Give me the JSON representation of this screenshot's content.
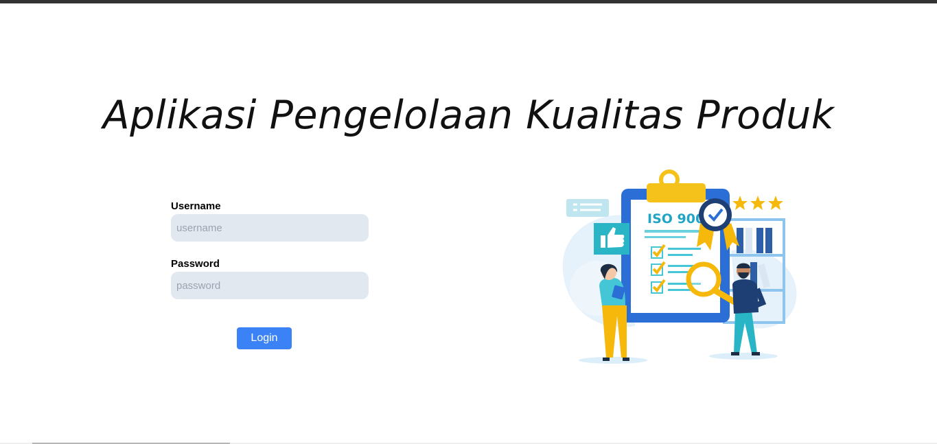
{
  "page": {
    "title": "Aplikasi Pengelolaan Kualitas Produk"
  },
  "login_form": {
    "username_label": "Username",
    "username_placeholder": "username",
    "username_value": "",
    "password_label": "Password",
    "password_placeholder": "password",
    "password_value": "",
    "login_button_label": "Login"
  },
  "illustration": {
    "badge_text": "ISO 9001",
    "icons": [
      "clipboard-icon",
      "thumbs-up-icon",
      "magnifier-icon",
      "certificate-seal-icon",
      "star-icon"
    ]
  },
  "colors": {
    "accent": "#3b82f6",
    "input_background": "#e2e8f0",
    "top_bar": "#333333"
  }
}
